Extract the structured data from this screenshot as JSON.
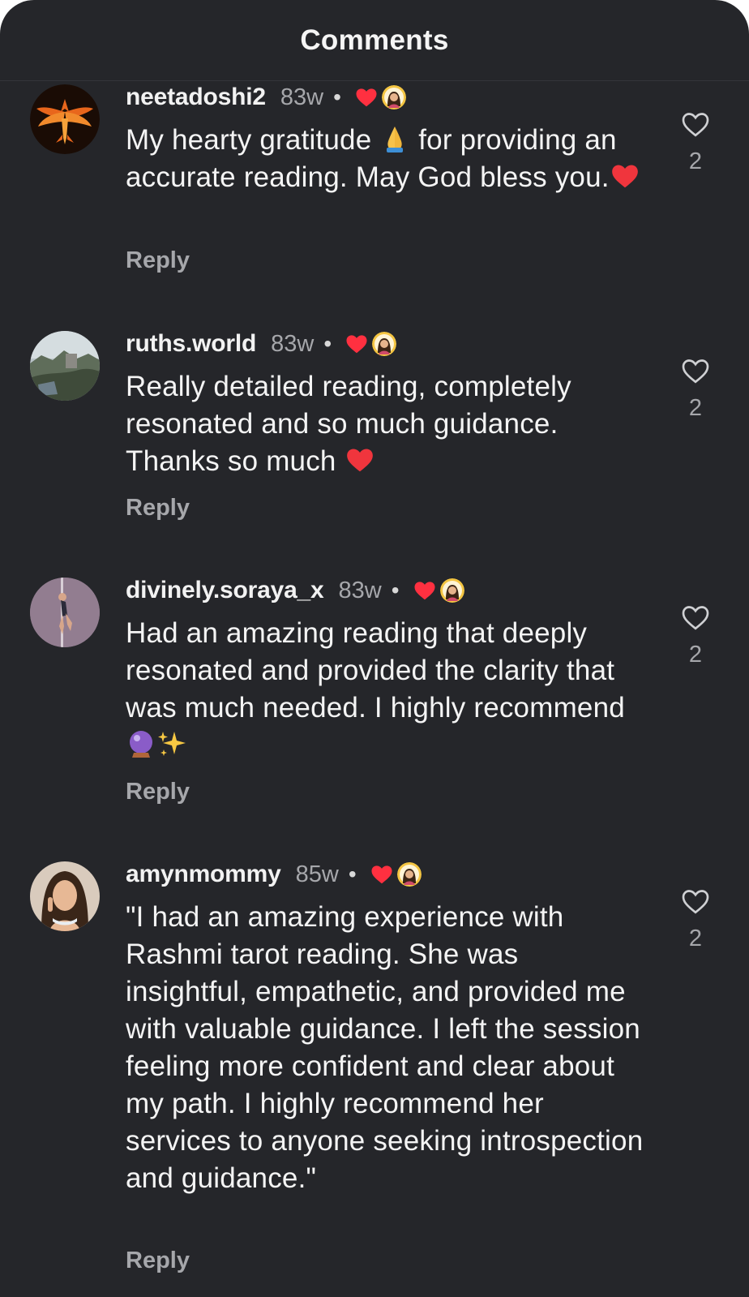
{
  "header": {
    "title": "Comments"
  },
  "colors": {
    "background": "#25262a",
    "text_primary": "#f4f4f4",
    "text_secondary": "#a6a7ab",
    "like_red": "#ff3040"
  },
  "comments": [
    {
      "username": "neetadoshi2",
      "time": "83w",
      "separator": "•",
      "text_parts": [
        "My hearty gratitude ",
        " for providing an accurate reading. May God bless you."
      ],
      "emojis": [
        "folded-hands-emoji",
        "red-heart-emoji"
      ],
      "reply_label": "Reply",
      "like_count": "2",
      "liked_by_creator": true,
      "avatar_icon": "phoenix-avatar"
    },
    {
      "username": "ruths.world",
      "time": "83w",
      "separator": "•",
      "text_parts": [
        "Really detailed reading, completely resonated and so much guidance. Thanks so much "
      ],
      "emojis": [
        "red-heart-emoji"
      ],
      "reply_label": "Reply",
      "like_count": "2",
      "liked_by_creator": true,
      "avatar_icon": "landscape-avatar"
    },
    {
      "username": "divinely.soraya_x",
      "time": "83w",
      "separator": "•",
      "text_parts": [
        "Had an amazing reading that deeply resonated and provided the clarity that was much needed. I highly recommend"
      ],
      "emojis": [
        "crystal-ball-emoji",
        "sparkles-emoji"
      ],
      "reply_label": "Reply",
      "like_count": "2",
      "liked_by_creator": true,
      "avatar_icon": "pole-dancer-avatar"
    },
    {
      "username": "amynmommy",
      "time": "85w",
      "separator": "•",
      "text_parts": [
        "\"I had an amazing experience with Rashmi tarot reading. She was insightful, empathetic, and provided me with valuable guidance. I left the session feeling more confident and clear about my path. I highly recommend her services to anyone seeking introspection and guidance.\""
      ],
      "emojis": [],
      "reply_label": "Reply",
      "like_count": "2",
      "liked_by_creator": true,
      "avatar_icon": "woman-portrait-avatar"
    }
  ]
}
